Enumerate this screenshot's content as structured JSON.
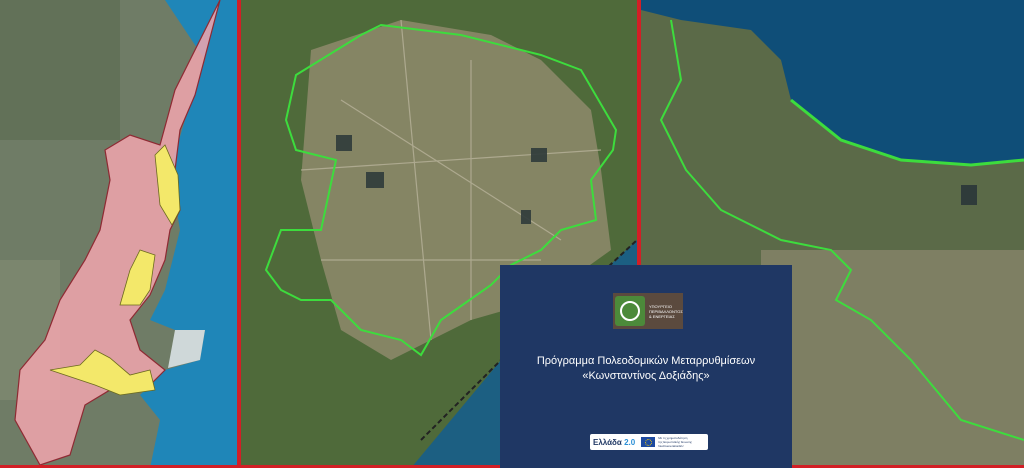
{
  "card": {
    "ministry_line1": "ΥΠΟΥΡΓΕΙΟ",
    "ministry_line2": "ΠΕΡΙΒΑΛΛΟΝΤΟΣ",
    "ministry_line3": "& ΕΝΕΡΓΕΙΑΣ",
    "title_line1": "Πρόγραμμα Πολεοδομικών Μεταρρυθμίσεων",
    "title_line2": "«Κωνσταντίνος Δοξιάδης»",
    "footer_greece": "Ελλάδα",
    "footer_greece_version": "2.0",
    "footer_eu_line1": "Με τη χρηματοδότηση",
    "footer_eu_line2": "της Ευρωπαϊκής Ένωσης",
    "footer_eu_line3": "NextGenerationEU"
  },
  "colors": {
    "divider": "#d21f26",
    "card_bg": "#1f3764",
    "boundary_green": "#3ddc3d",
    "zone_pink": "#f2a6ae",
    "zone_yellow": "#f3e86a",
    "sea": "#1f86b8"
  }
}
